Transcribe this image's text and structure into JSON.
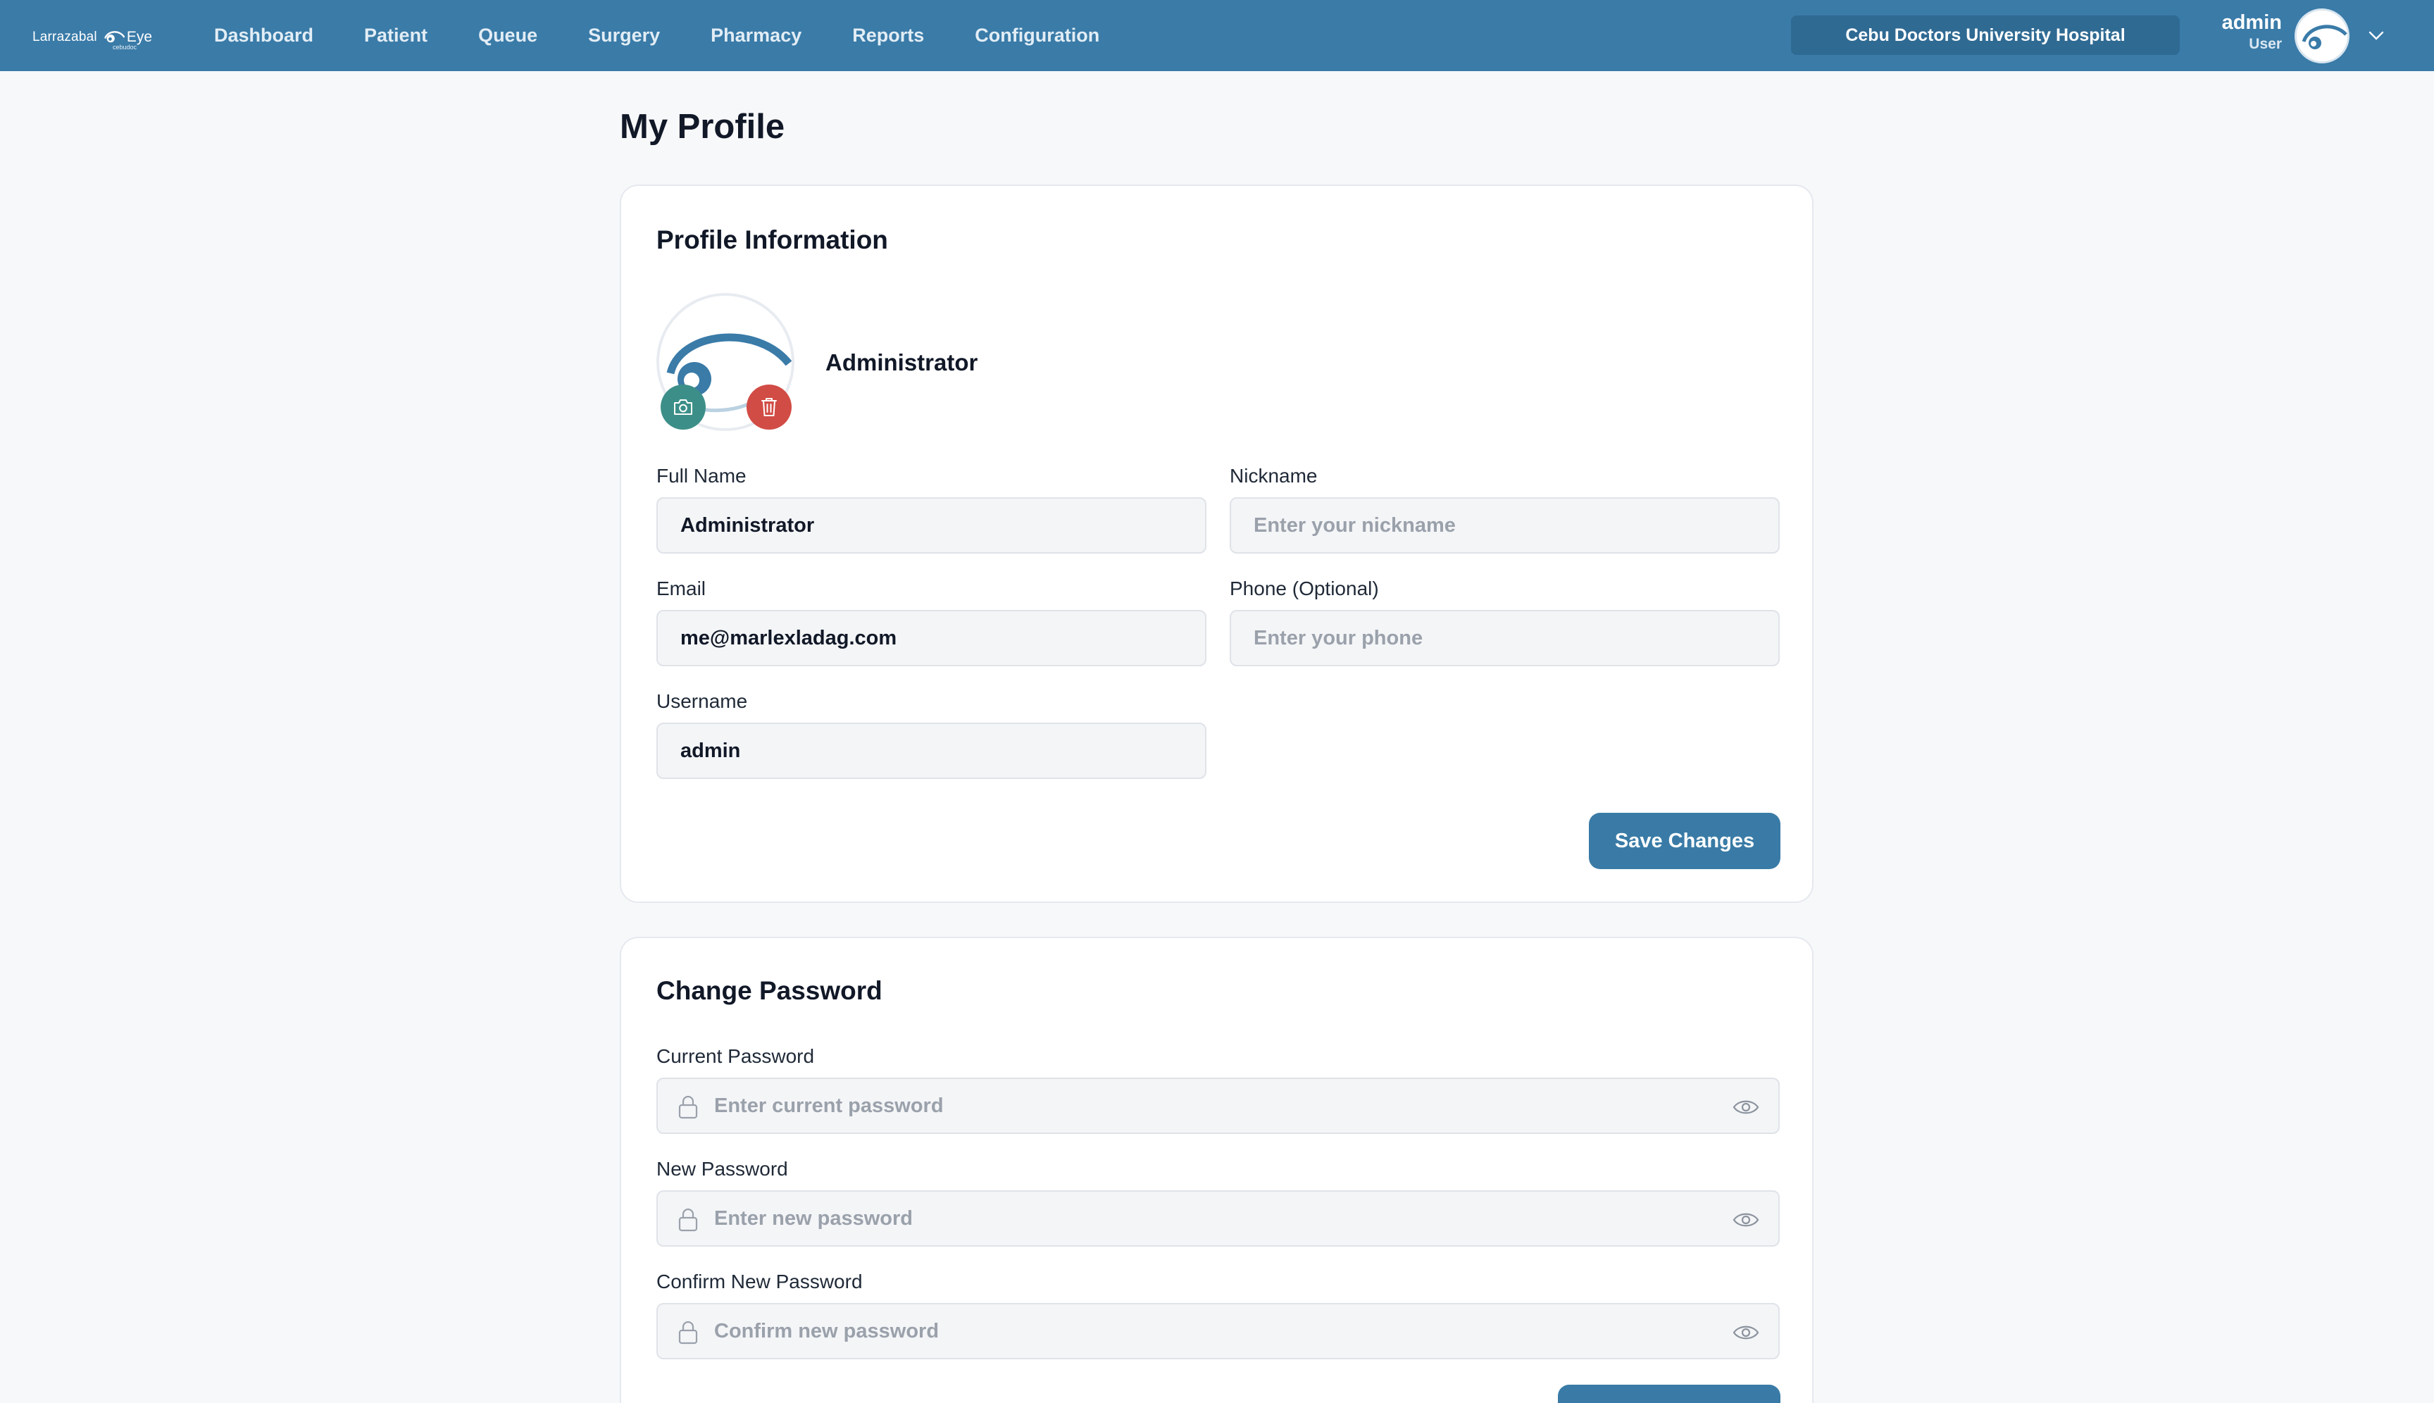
{
  "brand": {
    "logo_left": "Larrazabal",
    "logo_right": "Eye",
    "logo_sub": "cebudoc",
    "accent": "#3a7ba8"
  },
  "nav": {
    "items": [
      "Dashboard",
      "Patient",
      "Queue",
      "Surgery",
      "Pharmacy",
      "Reports",
      "Configuration"
    ]
  },
  "hospital": {
    "name": "Cebu Doctors University Hospital"
  },
  "user": {
    "name": "admin",
    "role": "User",
    "menu_icon": "chevron-down-icon"
  },
  "page": {
    "title": "My Profile"
  },
  "profile": {
    "section_title": "Profile Information",
    "display_name": "Administrator",
    "avatar_actions": {
      "camera_icon": "camera-icon",
      "delete_icon": "trash-icon"
    },
    "full_name": {
      "label": "Full Name",
      "value": "Administrator"
    },
    "nickname": {
      "label": "Nickname",
      "value": "",
      "placeholder": "Enter your nickname"
    },
    "email": {
      "label": "Email",
      "value": "me@marlexladag.com"
    },
    "phone": {
      "label": "Phone (Optional)",
      "value": "",
      "placeholder": "Enter your phone"
    },
    "username": {
      "label": "Username",
      "value": "admin"
    },
    "save_label": "Save Changes"
  },
  "password": {
    "section_title": "Change Password",
    "current": {
      "label": "Current Password",
      "placeholder": "Enter current password"
    },
    "new": {
      "label": "New Password",
      "placeholder": "Enter new password"
    },
    "confirm": {
      "label": "Confirm New Password",
      "placeholder": "Confirm new password"
    },
    "submit_label": ""
  },
  "colors": {
    "primary_button": "#397ba6",
    "camera_button": "#3c8f88",
    "delete_button": "#d14c45"
  }
}
